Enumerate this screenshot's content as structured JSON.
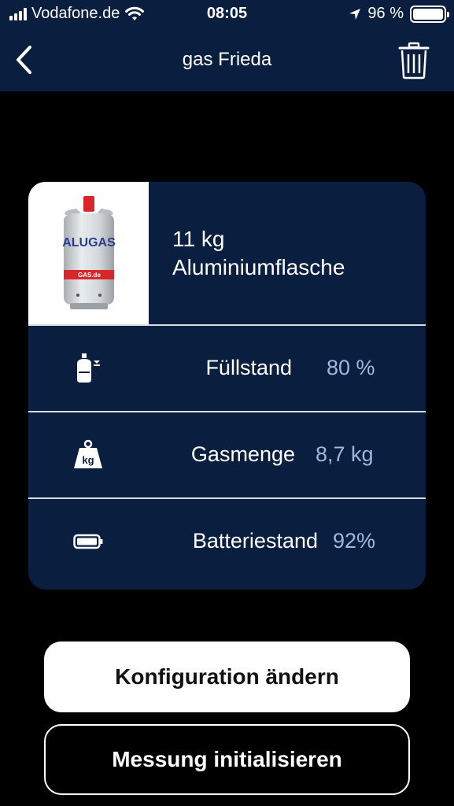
{
  "status_bar": {
    "carrier": "Vodafone.de",
    "time": "08:05",
    "battery_percent": "96 %"
  },
  "nav": {
    "title": "gas Frieda",
    "back_icon": "chevron-left-icon",
    "delete_icon": "trash-icon"
  },
  "bottle": {
    "image_brand_text": "ALUGAS",
    "image_sub_text": "GAS.de",
    "size": "11 kg",
    "type": "Aluminiumflasche"
  },
  "metrics": [
    {
      "icon": "gas-cylinder-icon",
      "label": "Füllstand",
      "value": "80 %"
    },
    {
      "icon": "weight-kg-icon",
      "label": "Gasmenge",
      "value": "8,7 kg"
    },
    {
      "icon": "battery-icon",
      "label": "Batteriestand",
      "value": "92%"
    }
  ],
  "buttons": {
    "configure": "Konfiguration ändern",
    "initialize": "Messung initialisieren"
  },
  "colors": {
    "header_bg": "#0a1f3f",
    "card_bg": "#0a1f3f",
    "value_text": "#9db9e0",
    "page_bg": "#000000"
  }
}
